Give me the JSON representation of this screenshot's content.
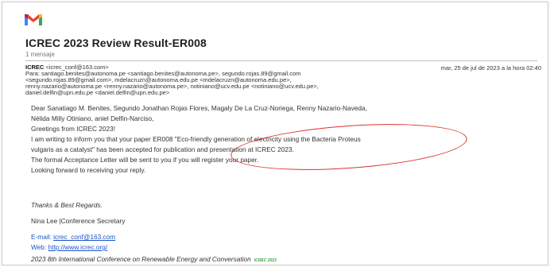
{
  "email": {
    "subject": "ICREC 2023 Review Result-ER008",
    "message_count": "1 mensaje",
    "from": {
      "name": "ICREC",
      "address": "<icrec_conf@163.com>"
    },
    "date": "mar, 25 de jul de 2023 a la hora 02:40",
    "recipients": [
      "Para: santiago.benites@autonoma.pe <santiago.benites@autonoma.pe>, segundo.rojas.89@gmail.com",
      "<segundo.rojas.89@gmail.com>, mdelacruzn@autonoma.edu.pe <mdelacruzn@autonoma.edu.pe>,",
      "renny.nazario@autonoma.pe <renny.nazario@autonoma.pe>, notiniano@ucv.edu.pe <notiniano@ucv.edu.pe>,",
      "daniel.delfin@upn.edu.pe <daniel.delfin@upn.edu.pe>"
    ],
    "body_lines": [
      "Dear Sanatiago M. Benites, Segundo Jonathan Rojas Flores, Magaly De La Cruz-Noriega, Renny Nazario-Naveda,",
      "Nélida Milly Otiniano, aniel Delfin-Narciso,",
      "Greetings from ICREC 2023!",
      "I am writing to inform you that your paper ER008 \"Eco-friendly generation of electricity using the Bacteria Proteus",
      "vulgaris as a catalyst\" has been accepted for publication and presentation at ICREC 2023.",
      "The formal Acceptance Letter will be sent to you if you will register your paper.",
      "Looking forward to receiving your reply."
    ],
    "regards": "Thanks & Best Regards.",
    "signature_name": "Nina Lee |Conference Secretary",
    "email_label": "E-mail:",
    "email_link": "icrec_conf@163.com",
    "web_label": "Web:",
    "web_link": "http://www.icrec.org/",
    "footer": "2023 8th International Conference on Renewable Energy and Conversation",
    "footer_badge": "ICREC 2023"
  },
  "colors": {
    "link": "#1a55c8",
    "annotation": "#d9342b",
    "gmail_red": "#ea4335"
  },
  "icons": [
    "gmail-logo-icon"
  ]
}
